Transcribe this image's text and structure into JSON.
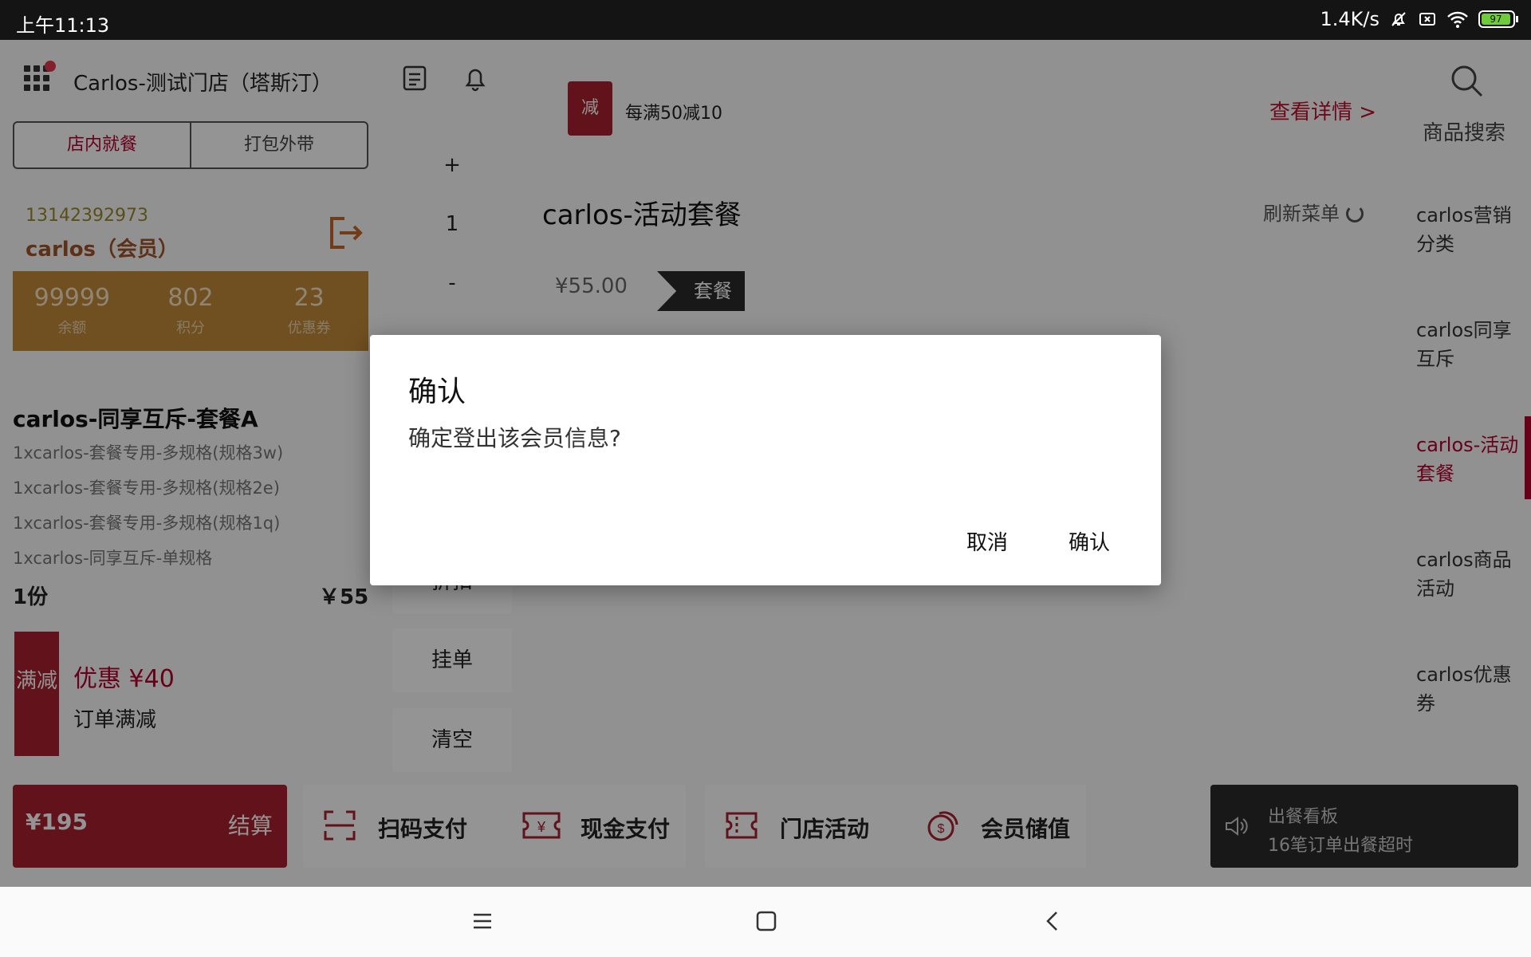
{
  "status_bar": {
    "time": "上午11:13",
    "net_speed": "1.4K/s",
    "battery": "97"
  },
  "header": {
    "store_name": "Carlos-测试门店（塔斯汀）"
  },
  "order_tabs": {
    "dine_in": "店内就餐",
    "takeaway": "打包外带"
  },
  "member": {
    "phone": "13142392973",
    "name": "carlos（会员）",
    "stats": [
      {
        "value": "99999",
        "label": "余额"
      },
      {
        "value": "802",
        "label": "积分"
      },
      {
        "value": "23",
        "label": "优惠券"
      }
    ]
  },
  "order": {
    "title": "carlos-同享互斥-套餐A",
    "items": [
      "1xcarlos-套餐专用-多规格(规格3w)",
      "1xcarlos-套餐专用-多规格(规格2e)",
      "1xcarlos-套餐专用-多规格(规格1q)",
      "1xcarlos-同享互斥-单规格"
    ],
    "quantity": "1份",
    "price": "￥55"
  },
  "promotion": {
    "tag": "满减",
    "amount": "优惠 ¥40",
    "desc": "订单满减"
  },
  "middle": {
    "plus": "+",
    "count": "1",
    "minus": "-",
    "discount": "折扣",
    "hold": "挂单",
    "clear": "清空"
  },
  "banner": {
    "badge": "减",
    "text": "每满50减10",
    "detail_link": "查看详情 >"
  },
  "search": {
    "label": "商品搜索"
  },
  "category": {
    "title": "carlos-活动套餐",
    "refresh": "刷新菜单",
    "item_price": "¥55.00",
    "item_tag": "套餐"
  },
  "sidebar": {
    "items": [
      "carlos营销分类",
      "carlos同享互斥",
      "carlos-活动套餐",
      "carlos商品活动",
      "carlos优惠券"
    ],
    "active_index": 2
  },
  "bottom": {
    "total": "¥195",
    "checkout": "结算",
    "scan_pay": "扫码支付",
    "cash_pay": "现金支付",
    "store_activity": "门店活动",
    "member_topup": "会员储值",
    "board_title": "出餐看板",
    "board_msg": "16笔订单出餐超时"
  },
  "dialog": {
    "title": "确认",
    "message": "确定登出该会员信息?",
    "cancel": "取消",
    "confirm": "确认"
  },
  "colors": {
    "brand": "#a8202e",
    "accent_text": "#b3002d",
    "member_bar": "#c18a3a"
  }
}
